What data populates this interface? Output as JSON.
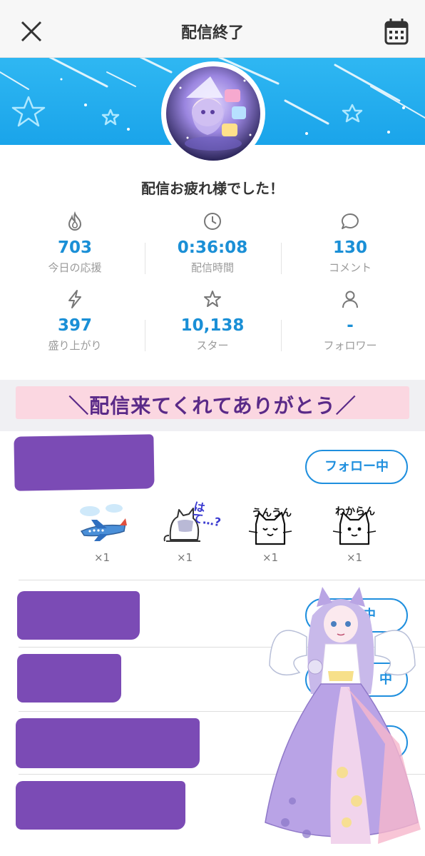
{
  "header": {
    "title": "配信終了",
    "close_icon": "close-icon",
    "calendar_icon": "calendar-icon"
  },
  "message": "配信お疲れ様でした！",
  "stats": [
    {
      "icon": "flame-icon",
      "value": "703",
      "label": "今日の応援"
    },
    {
      "icon": "clock-icon",
      "value": "0:36:08",
      "label": "配信時間"
    },
    {
      "icon": "comment-icon",
      "value": "130",
      "label": "コメント"
    },
    {
      "icon": "lightning-icon",
      "value": "397",
      "label": "盛り上がり"
    },
    {
      "icon": "star-icon",
      "value": "10,138",
      "label": "スター"
    },
    {
      "icon": "person-icon",
      "value": "-",
      "label": "フォロワー"
    }
  ],
  "thanks_banner": "＼配信来てくれてありがとう／",
  "viewers": [
    {
      "follow_label": "フォロー中",
      "gifts": [
        {
          "icon": "airplane-gift-icon",
          "count": "×1"
        },
        {
          "icon": "cat-hate-gift-icon",
          "title": "はて…?",
          "count": "×1"
        },
        {
          "icon": "cat-unun-gift-icon",
          "title": "うんうん",
          "count": "×1"
        },
        {
          "icon": "cat-wakaran-gift-icon",
          "title": "わからん",
          "count": "×1"
        }
      ]
    },
    {
      "follow_label": "ロー中"
    },
    {
      "follow_label": "中"
    }
  ],
  "colors": {
    "accent": "#1a8fd6",
    "banner": "#1aa4ea",
    "thanks_bg": "#fbd7e1",
    "thanks_text": "#5a2a88",
    "redaction": "#7b4bb5"
  }
}
